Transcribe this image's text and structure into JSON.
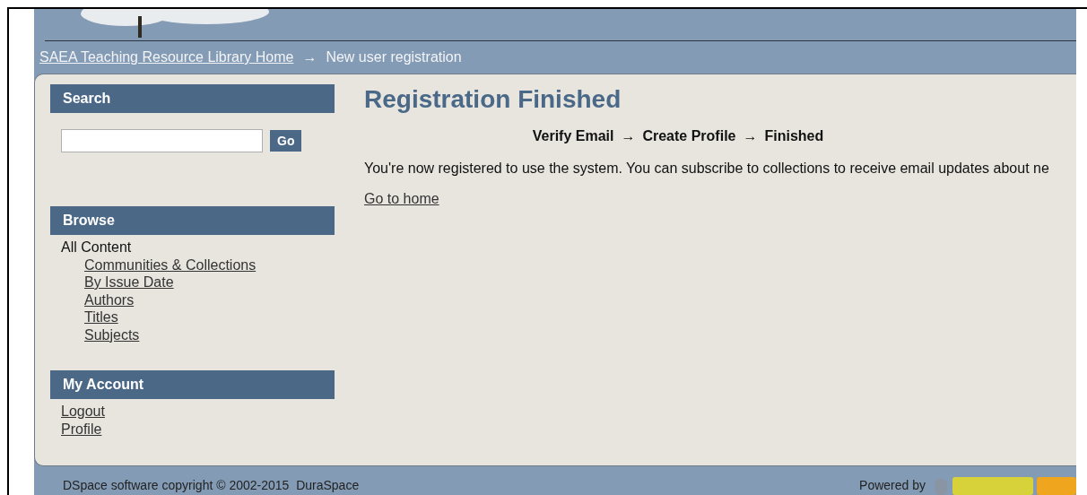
{
  "breadcrumbs": [
    {
      "label": "SAEA Teaching Resource Library Home",
      "kind": "link"
    },
    {
      "label": "→",
      "kind": "separator"
    },
    {
      "label": "New user registration",
      "kind": "current"
    }
  ],
  "sidebar": [
    {
      "title": "Search",
      "kind": "search",
      "button": "Go"
    },
    {
      "title": "Browse",
      "kind": "links",
      "heading": "All Content",
      "items": [
        "Communities & Collections",
        "By Issue Date",
        "Authors",
        "Titles",
        "Subjects"
      ]
    },
    {
      "title": "My Account",
      "kind": "links",
      "items": [
        "Logout",
        "Profile"
      ]
    }
  ],
  "main": {
    "title": "Registration Finished",
    "steps": [
      "Verify Email",
      "Create Profile",
      "Finished"
    ],
    "step_separators": [
      "→",
      "→"
    ],
    "message": "You're now registered to use the system. You can subscribe to collections to receive email updates about ne",
    "link": "Go to home"
  },
  "footer": {
    "copyright": "DSpace software copyright © 2002-2015  DuraSpace",
    "powered": "Powered by"
  }
}
